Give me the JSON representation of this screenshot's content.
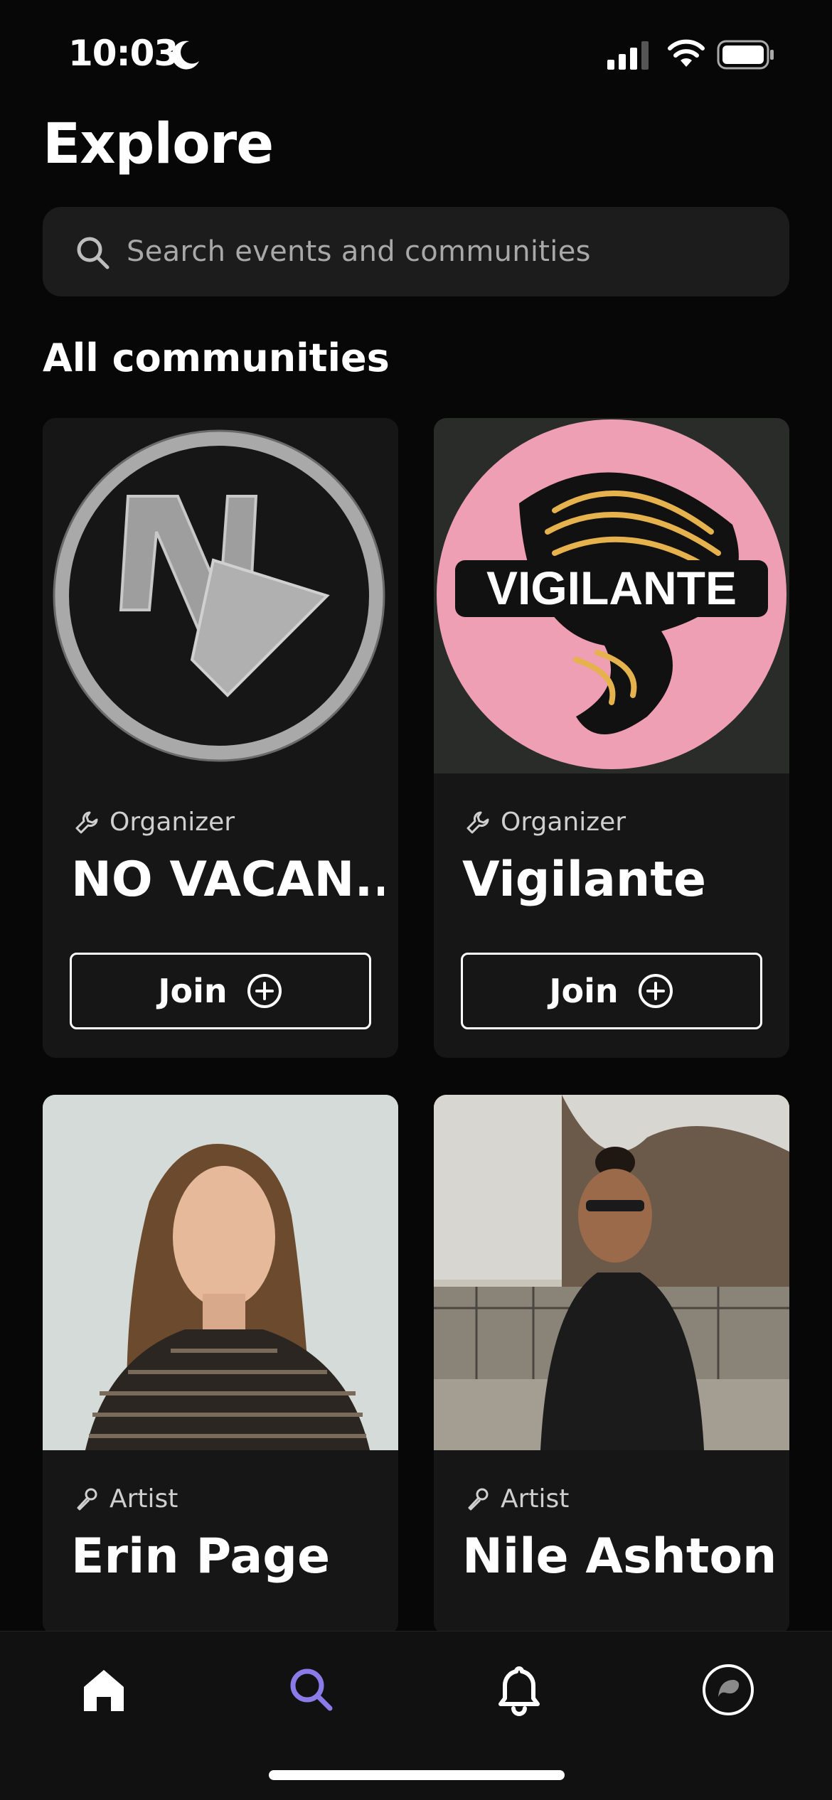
{
  "status_bar": {
    "time": "10:03"
  },
  "header": {
    "title": "Explore"
  },
  "search": {
    "placeholder": "Search events and communities"
  },
  "section": {
    "title": "All communities"
  },
  "communities": [
    {
      "role": "Organizer",
      "name": "NO VACAN...",
      "join_label": "Join",
      "logo_text": "NV"
    },
    {
      "role": "Organizer",
      "name": "Vigilante",
      "join_label": "Join",
      "logo_text": "VIGILANTE"
    },
    {
      "role": "Artist",
      "name": "Erin Page"
    },
    {
      "role": "Artist",
      "name": "Nile Ashton"
    }
  ],
  "tabbar": {
    "items": [
      "home-icon",
      "search-icon",
      "bell-icon",
      "profile-icon"
    ],
    "active": "search-icon",
    "active_color": "#8b7be8"
  }
}
